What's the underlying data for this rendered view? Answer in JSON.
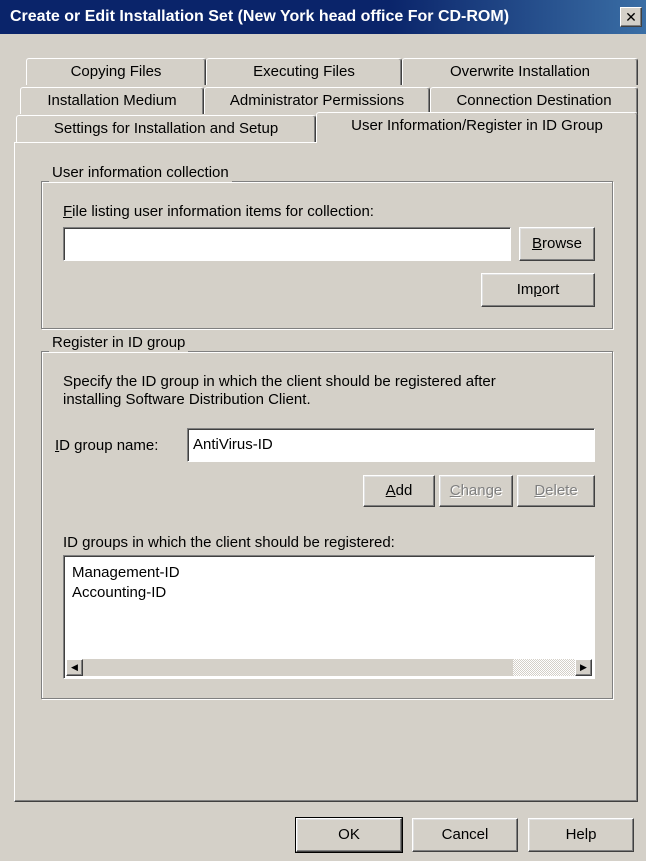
{
  "window": {
    "title": "Create or Edit Installation Set (New York head office For CD-ROM)",
    "close_glyph": "✕"
  },
  "tabs": {
    "row1": [
      "Copying Files",
      "Executing Files",
      "Overwrite Installation"
    ],
    "row2": [
      "Installation Medium",
      "Administrator Permissions",
      "Connection Destination"
    ],
    "row3": [
      "Settings for Installation and Setup",
      "User Information/Register in ID Group"
    ],
    "active": "User Information/Register in ID Group"
  },
  "user_info": {
    "group_title": "User information collection",
    "file_label_mnemonic": "F",
    "file_label_rest": "ile listing user information items for collection:",
    "file_value": "",
    "browse_mnemonic": "B",
    "browse_rest": "rowse",
    "import_pre": "Im",
    "import_mnemonic": "p",
    "import_rest": "ort"
  },
  "register": {
    "group_title": "Register in ID group",
    "description_line1": "Specify the ID group in which the client should be registered after",
    "description_line2": "installing Software Distribution Client.",
    "id_label_mnemonic": "I",
    "id_label_rest": "D group name:",
    "id_value": "AntiVirus-ID",
    "add_mnemonic": "A",
    "add_rest": "dd",
    "change_mnemonic": "C",
    "change_rest": "hange",
    "delete_mnemonic": "D",
    "delete_rest": "elete",
    "list_label": "ID groups in which the client should be registered:",
    "list_items": [
      "Management-ID",
      "Accounting-ID"
    ],
    "scroll_left": "◀",
    "scroll_right": "▶"
  },
  "footer": {
    "ok": "OK",
    "cancel": "Cancel",
    "help": "Help"
  },
  "colors": {
    "dialog_bg": "#d4d0c8",
    "titlebar": "#0a246a",
    "field_bg": "#ffffff"
  }
}
